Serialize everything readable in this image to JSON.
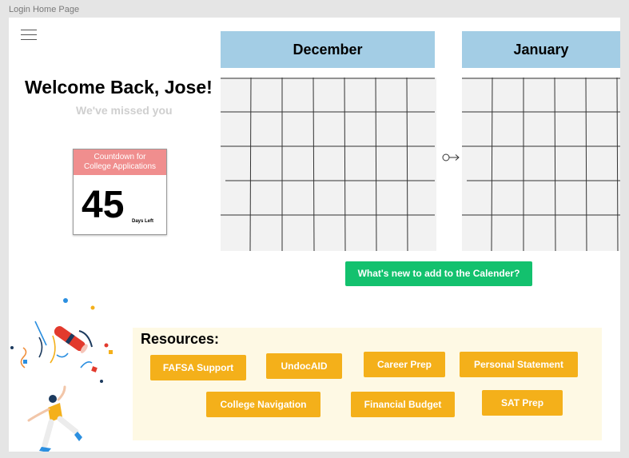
{
  "frame_label": "Login Home Page",
  "welcome": {
    "title": "Welcome Back, Jose!",
    "subtitle": "We've missed you"
  },
  "countdown": {
    "header_line1": "Countdown for",
    "header_line2": "College Applications",
    "number": "45",
    "unit": "Days Left"
  },
  "calendars": [
    {
      "month": "December"
    },
    {
      "month": "January"
    }
  ],
  "next_icon": "arrow-right-icon",
  "cta_label": "What's new to add to the Calender?",
  "resources": {
    "title": "Resources:",
    "items": [
      {
        "label": "FAFSA Support"
      },
      {
        "label": "UndocAID"
      },
      {
        "label": "Career Prep"
      },
      {
        "label": "Personal Statement"
      },
      {
        "label": "College Navigation"
      },
      {
        "label": "Financial Budget"
      },
      {
        "label": "SAT Prep"
      }
    ]
  },
  "colors": {
    "calendar_header": "#a3cde5",
    "countdown_header": "#f08e8e",
    "cta": "#13c16e",
    "resource_button": "#f4b01a",
    "resources_bg": "#fef9e4"
  }
}
